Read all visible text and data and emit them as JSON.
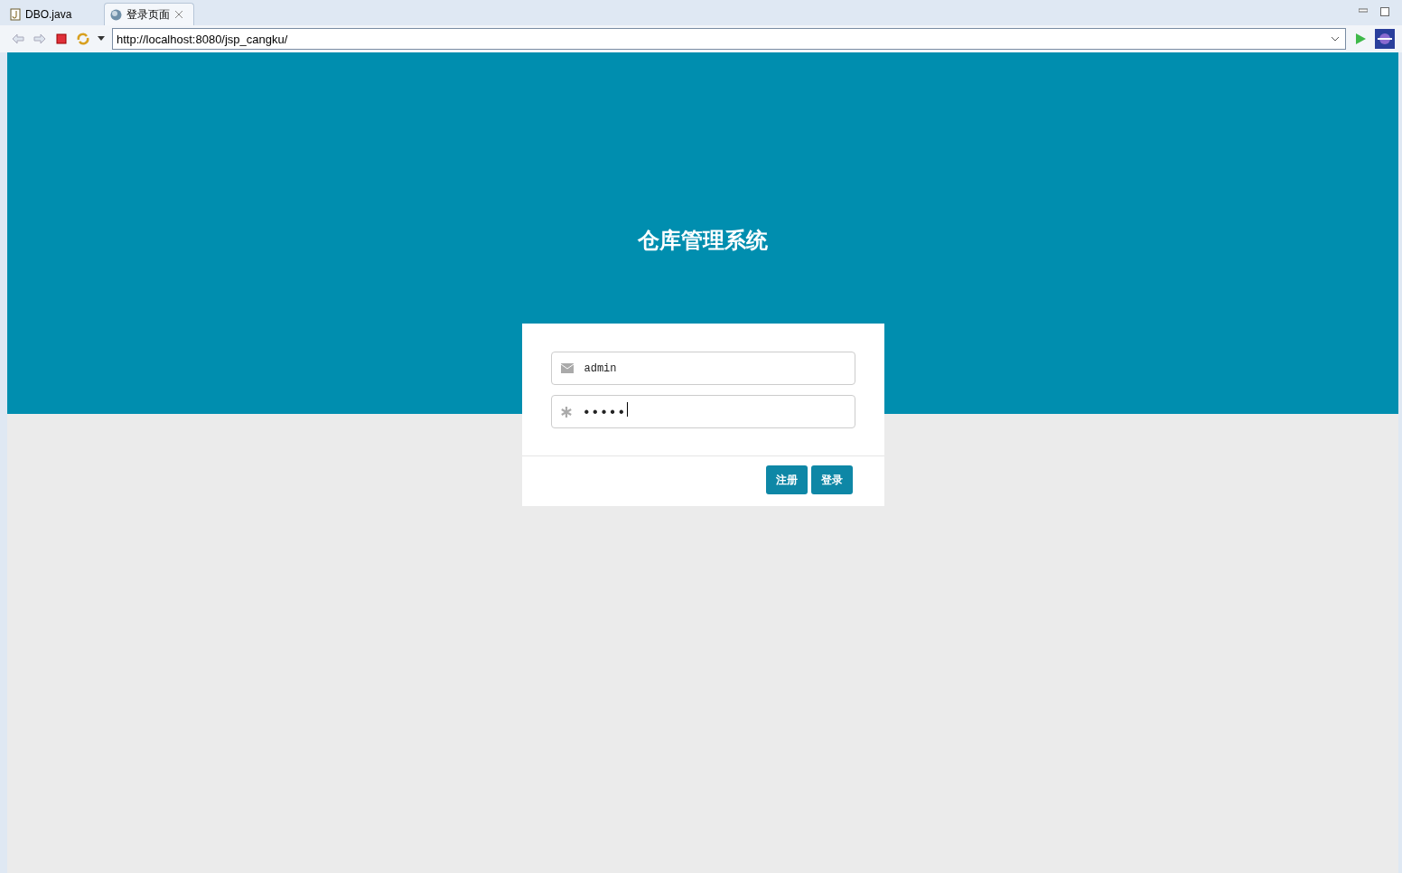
{
  "tabs": [
    {
      "label": "DBO.java",
      "kind": "java",
      "selected": false
    },
    {
      "label": "登录页面",
      "kind": "web",
      "selected": true
    }
  ],
  "address": {
    "value": "http://localhost:8080/jsp_cangku/"
  },
  "page": {
    "title": "仓库管理系统",
    "fields": [
      {
        "kind": "user",
        "value": "admin"
      },
      {
        "kind": "password",
        "value": "•••••"
      }
    ],
    "buttons": [
      {
        "label": "注册"
      },
      {
        "label": "登录"
      }
    ]
  }
}
